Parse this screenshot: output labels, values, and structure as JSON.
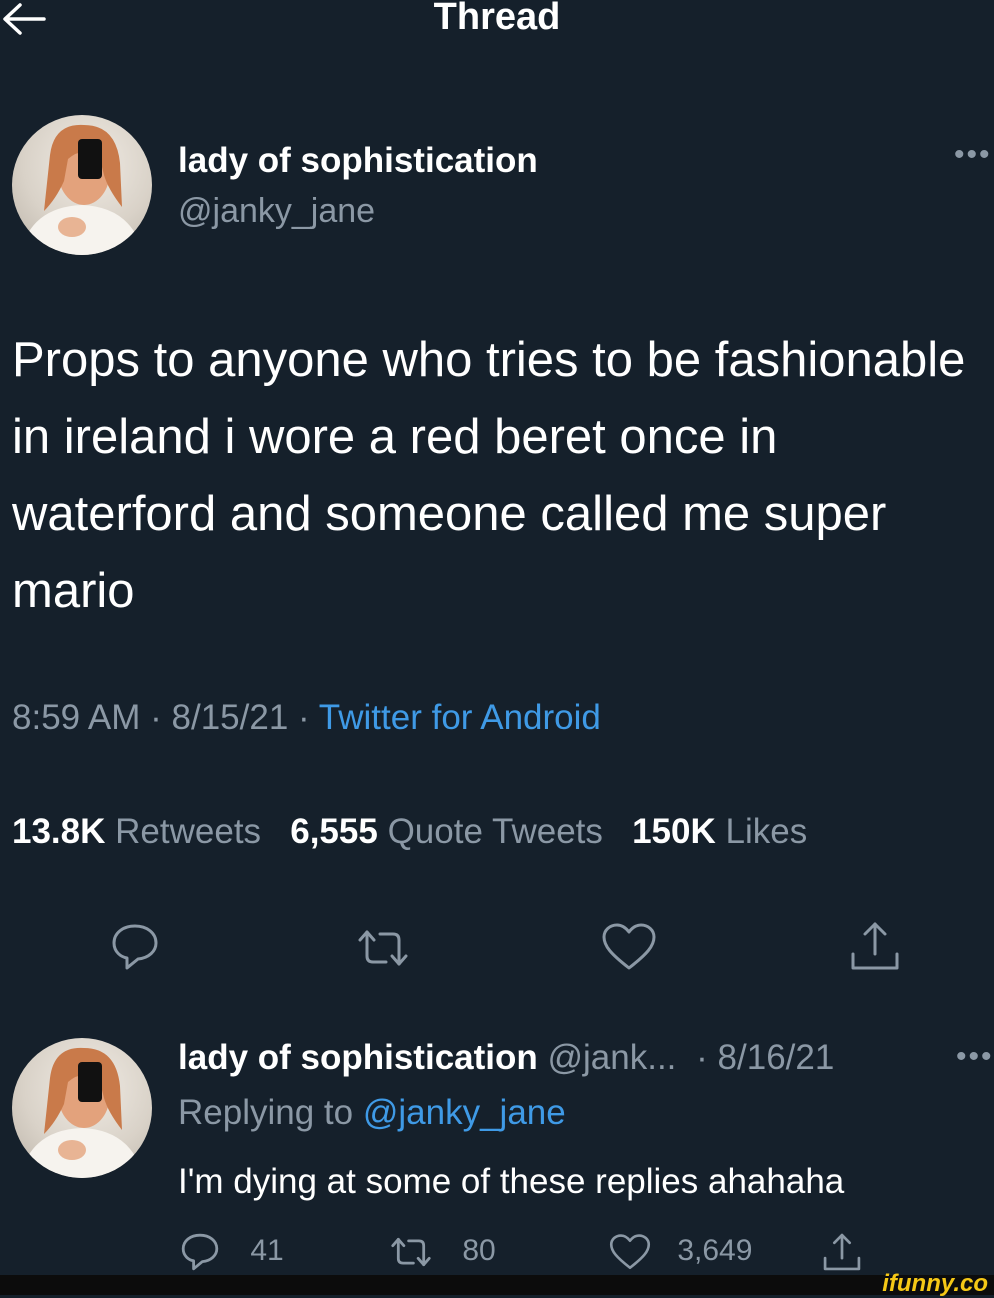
{
  "header": {
    "title": "Thread"
  },
  "tweet": {
    "name": "lady of sophistication",
    "handle": "@janky_jane",
    "text": "Props to anyone who tries to be fashionable in ireland i wore a red beret once in waterford and someone called me super mario",
    "time": "8:59 AM",
    "date": "8/15/21",
    "dot": " · ",
    "source": "Twitter for Android",
    "stats": {
      "retweets_count": "13.8K",
      "retweets_label": "Retweets",
      "quotes_count": "6,555",
      "quotes_label": "Quote Tweets",
      "likes_count": "150K",
      "likes_label": "Likes"
    }
  },
  "reply": {
    "name": "lady of sophistication",
    "handle": "@jank...",
    "date": "· 8/16/21",
    "replying_prefix": "Replying to",
    "replying_handle": "@janky_jane",
    "text": "I'm dying at some of these replies ahahaha",
    "counts": {
      "replies": "41",
      "retweets": "80",
      "likes": "3,649"
    }
  },
  "watermark": "ifunny.co",
  "colors": {
    "background": "#15202b",
    "muted": "#8b98a5",
    "link": "#3f9ae6"
  }
}
